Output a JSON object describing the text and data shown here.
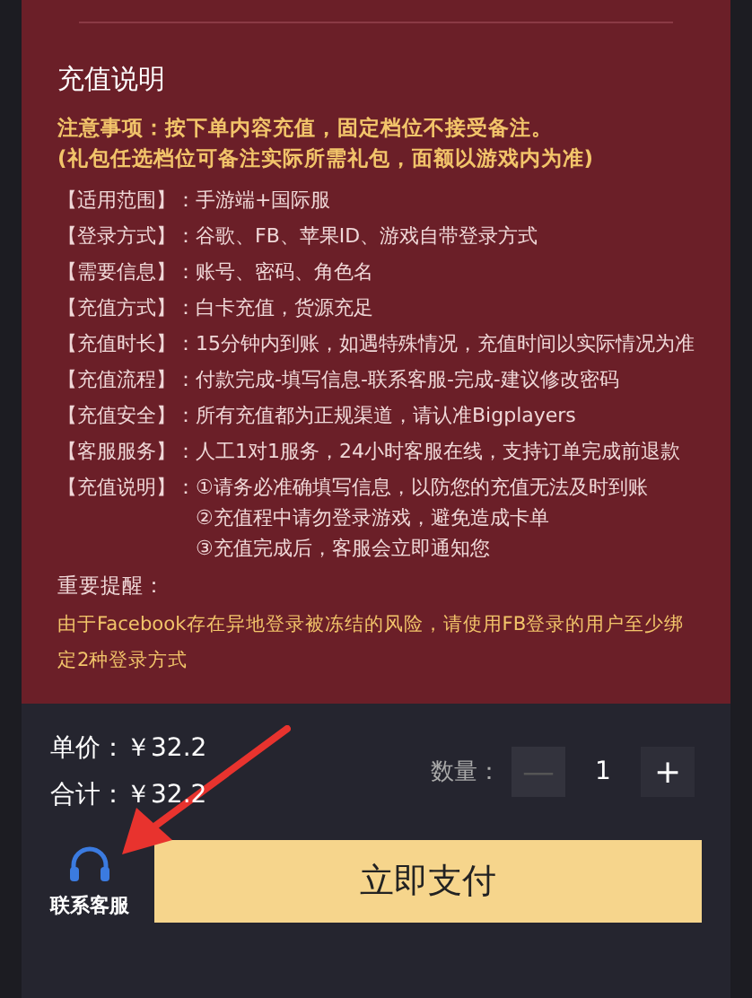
{
  "section_title": "充值说明",
  "notice": [
    "注意事项：按下单内容充值，固定档位不接受备注。",
    "(礼包任选档位可备注实际所需礼包，面额以游戏内为准)"
  ],
  "details": [
    {
      "label": "【适用范围】：",
      "lines": [
        "手游端+国际服"
      ]
    },
    {
      "label": "【登录方式】：",
      "lines": [
        "谷歌、FB、苹果ID、游戏自带登录方式"
      ]
    },
    {
      "label": "【需要信息】：",
      "lines": [
        "账号、密码、角色名"
      ]
    },
    {
      "label": "【充值方式】：",
      "lines": [
        "白卡充值，货源充足"
      ]
    },
    {
      "label": "【充值时长】：",
      "lines": [
        "15分钟内到账，如遇特殊情况，充值时间以实际情况为准"
      ]
    },
    {
      "label": "【充值流程】：",
      "lines": [
        "付款完成-填写信息-联系客服-完成-建议修改密码"
      ]
    },
    {
      "label": "【充值安全】：",
      "lines": [
        "所有充值都为正规渠道，请认准Bigplayers"
      ]
    },
    {
      "label": "【客服服务】：",
      "lines": [
        "人工1对1服务，24小时客服在线，支持订单完成前退款"
      ]
    },
    {
      "label": "【充值说明】：",
      "lines": [
        "①请务必准确填写信息，以防您的充值无法及时到账",
        "②充值程中请勿登录游戏，避免造成卡单",
        "③充值完成后，客服会立即通知您"
      ]
    }
  ],
  "reminder": {
    "title": "重要提醒：",
    "text": "由于Facebook存在异地登录被冻结的风险，请使用FB登录的用户至少绑定2种登录方式"
  },
  "price": {
    "unit_label": "单价：",
    "unit_value": "￥32.2",
    "total_label": "合计：",
    "total_value": "￥32.2"
  },
  "quantity": {
    "label": "数量：",
    "minus": "—",
    "value": "1",
    "plus": "+",
    "minus_disabled": true
  },
  "support": {
    "label": "联系客服"
  },
  "pay_button": "立即支付"
}
